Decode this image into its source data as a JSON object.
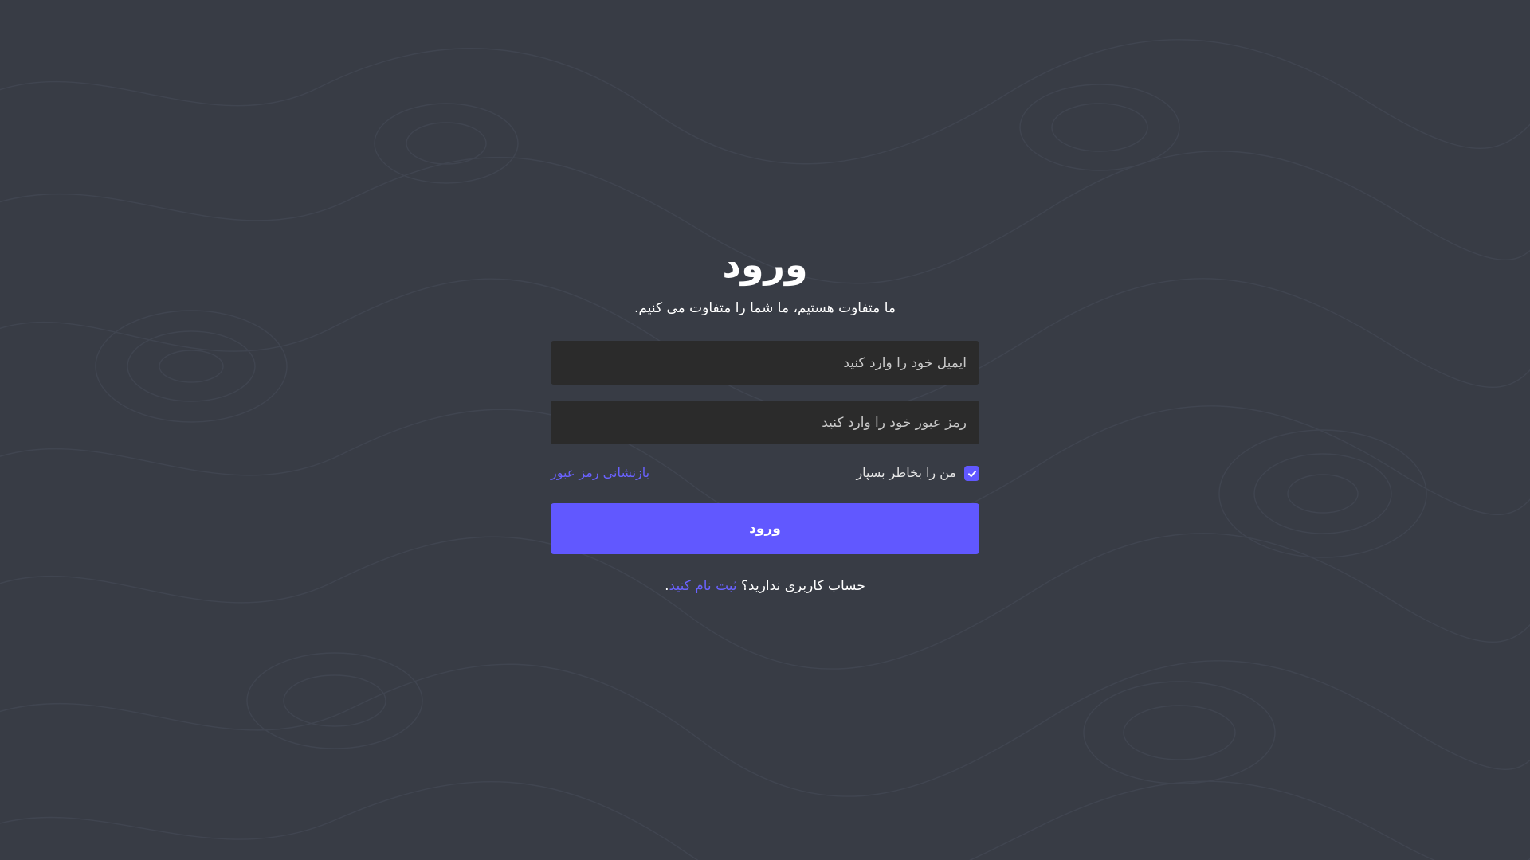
{
  "login": {
    "title": "ورود",
    "subtitle": "ما متفاوت هستیم، ما شما را متفاوت می کنیم.",
    "email_placeholder": "ایمیل خود را وارد کنید",
    "password_placeholder": "رمز عبور خود را وارد کنید",
    "remember_label": "من را بخاطر بسپار",
    "remember_checked": true,
    "forgot_label": "بازنشانی رمز عبور",
    "submit_label": "ورود",
    "signup_prompt": "حساب کاربری ندارید؟ ",
    "signup_link": "ثبت نام کنید",
    "signup_suffix": "."
  },
  "colors": {
    "background": "#383c45",
    "input_background": "#2b2b2b",
    "accent": "#6158ff",
    "link": "#6a62ff"
  },
  "icons": {
    "checkbox": "check-icon",
    "background": "topographic-pattern"
  }
}
